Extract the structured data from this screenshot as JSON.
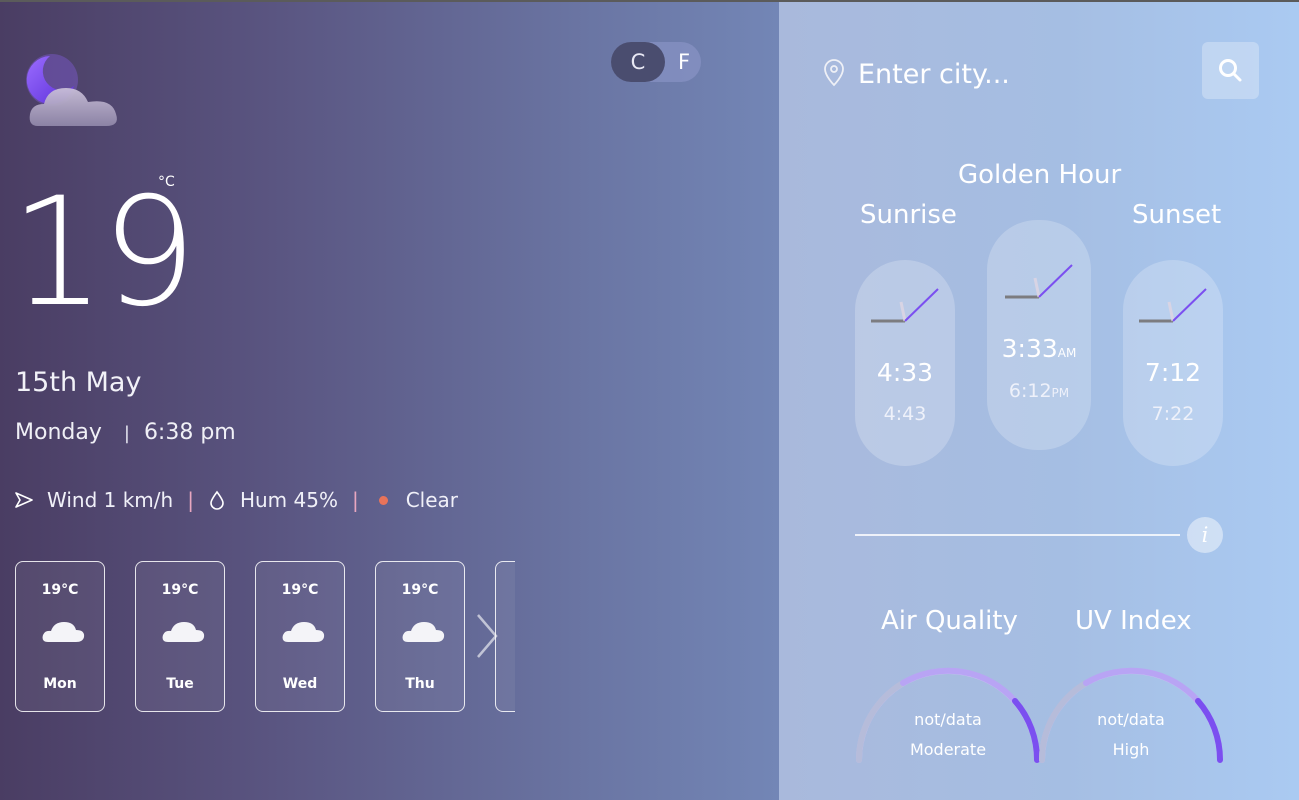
{
  "current": {
    "temperature": "19",
    "unit": "°C",
    "date": "15th May",
    "day": "Monday",
    "separator": "|",
    "time": "6:38 pm",
    "wind": "Wind 1 km/h",
    "humidity": "Hum 45%",
    "condition": "Clear",
    "divider": "|"
  },
  "unit_toggle": {
    "celsius": "C",
    "fahrenheit": "F",
    "selected": "C"
  },
  "forecast": [
    {
      "temp": "19°C",
      "day": "Mon",
      "icon": "cloud-icon"
    },
    {
      "temp": "19°C",
      "day": "Tue",
      "icon": "cloud-icon"
    },
    {
      "temp": "19°C",
      "day": "Wed",
      "icon": "cloud-icon"
    },
    {
      "temp": "19°C",
      "day": "Thu",
      "icon": "cloud-icon"
    }
  ],
  "search": {
    "placeholder": "Enter city..."
  },
  "golden_hour": {
    "title": "Golden Hour",
    "sunrise": {
      "label": "Sunrise",
      "primary": "4:33",
      "secondary": "4:43"
    },
    "middle": {
      "primary": "3:33",
      "primary_suffix": "AM",
      "secondary": "6:12",
      "secondary_suffix": "PM"
    },
    "sunset": {
      "label": "Sunset",
      "primary": "7:12",
      "secondary": "7:22"
    }
  },
  "info_label": "i",
  "air_quality": {
    "title": "Air Quality",
    "value": "not/data",
    "level": "Moderate"
  },
  "uv_index": {
    "title": "UV Index",
    "value": "not/data",
    "level": "High"
  },
  "colors": {
    "accent_purple": "#7b4ff0",
    "gauge_track": "#c7b9f6",
    "condition_dot": "#e8735a",
    "separator_pink": "#e8a7c0"
  }
}
